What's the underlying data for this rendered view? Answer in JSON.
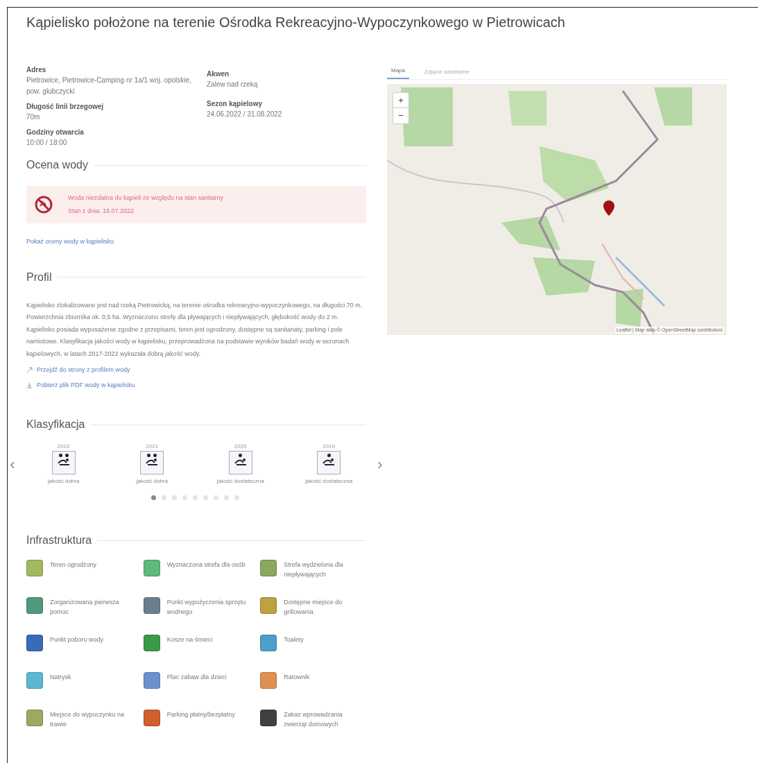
{
  "page_title": "Kąpielisko położone na terenie Ośrodka Rekreacyjno-Wypoczynkowego w Pietrowicach",
  "details": {
    "left": [
      {
        "label": "Adres",
        "value": "Pietrowice, Pietrowice-Camping nr 1a/1 woj. opolskie, pow. głubczycki"
      },
      {
        "label": "Długość linii brzegowej",
        "value": "70m"
      },
      {
        "label": "Godziny otwarcia",
        "value": "10:00 / 18:00"
      }
    ],
    "right": [
      {
        "label": "Akwen",
        "value": "Zalew nad rzeką"
      },
      {
        "label": "Sezon kąpielowy",
        "value": "24.06.2022 / 31.08.2022"
      }
    ]
  },
  "water_assessment": {
    "heading": "Ocena wody",
    "unfit": true,
    "message": "Woda niezdatna do kąpieli ze względu na stan sanitarny",
    "date": "Stan z dnia: 16.07.2022",
    "link": "Pokaż oceny wody w kąpielisku"
  },
  "profile": {
    "heading": "Profil",
    "text": "Kąpielisko zlokalizowane jest nad rzeką Pietrowicką, na terenie ośrodka rekreacyjno-wypoczynkowego, na długości 70 m. Powierzchnia zbiornika ok. 0,5 ha. Wyznaczono strefę dla pływających i niepływających, głębokość wody do 2 m. Kąpielisko posiada wyposażenie zgodne z przepisami, teren jest ogrodzony, dostępne są sanitariaty, parking i pole namiotowe. Klasyfikacja jakości wody w kąpielisku, przeprowadzona na podstawie wyników badań wody w sezonach kąpielowych, w latach 2017-2022 wykazała dobrą jakość wody.",
    "links": [
      {
        "kind": "link",
        "text": "Przejdź do strony z profilem wody"
      },
      {
        "kind": "download",
        "text": "Pobierz plik PDF wody w kąpielisku"
      }
    ]
  },
  "classification": {
    "heading": "Klasyfikacja",
    "items": [
      {
        "year": "2022",
        "label": "jakość dobra",
        "kind": "good"
      },
      {
        "year": "2021",
        "label": "jakość dobra",
        "kind": "good"
      },
      {
        "year": "2020",
        "label": "jakość dostateczna",
        "kind": "sufficient"
      },
      {
        "year": "2019",
        "label": "jakość dostateczna",
        "kind": "sufficient"
      }
    ],
    "pages": [
      {
        "selected": true
      },
      {
        "selected": false
      },
      {
        "selected": false
      },
      {
        "selected": false
      },
      {
        "selected": false
      },
      {
        "selected": false
      },
      {
        "selected": false
      },
      {
        "selected": false
      },
      {
        "selected": false
      }
    ],
    "prev": "‹",
    "next": "›"
  },
  "infrastructure": {
    "heading": "Infrastruktura",
    "items": [
      {
        "label": "Teren ogrodzony",
        "color": "#a3b860"
      },
      {
        "label": "Wyznaczona strefa dla osób",
        "color": "#5cba7a"
      },
      {
        "label": "Strefa wydzielona dla niepływających",
        "color": "#8aa860"
      },
      {
        "label": "Zorganizowana pierwsza pomoc",
        "color": "#4f9a7a"
      },
      {
        "label": "Punkt wypożyczenia sprzętu wodnego",
        "color": "#6a7e8e"
      },
      {
        "label": "Dostępne miejsce do grillowania",
        "color": "#c0a040"
      },
      {
        "label": "Punkt poboru wody",
        "color": "#3a6ab8"
      },
      {
        "label": "Kosze na śmieci",
        "color": "#3a9a4a"
      },
      {
        "label": "Toalety",
        "color": "#4aa0c8"
      },
      {
        "label": "Natrysk",
        "color": "#5ab8d0"
      },
      {
        "label": "Plac zabaw dla dzieci",
        "color": "#6a90d0"
      },
      {
        "label": "Ratownik",
        "color": "#e09050"
      },
      {
        "label": "Miejsce do wypoczynku na trawie",
        "color": "#9aaa60"
      },
      {
        "label": "Parking płatny/bezpłatny",
        "color": "#d06030"
      },
      {
        "label": "Zakaz wprowadzania zwierząt domowych",
        "color": "#404040"
      }
    ]
  },
  "map": {
    "tabs": [
      {
        "label": "Mapa",
        "selected": true
      },
      {
        "label": "Zdjęcie satelitarne",
        "selected": false
      }
    ],
    "zoom_in": "+",
    "zoom_out": "−",
    "attribution": "Leaflet | Map data © OpenStreetMap contributors"
  }
}
